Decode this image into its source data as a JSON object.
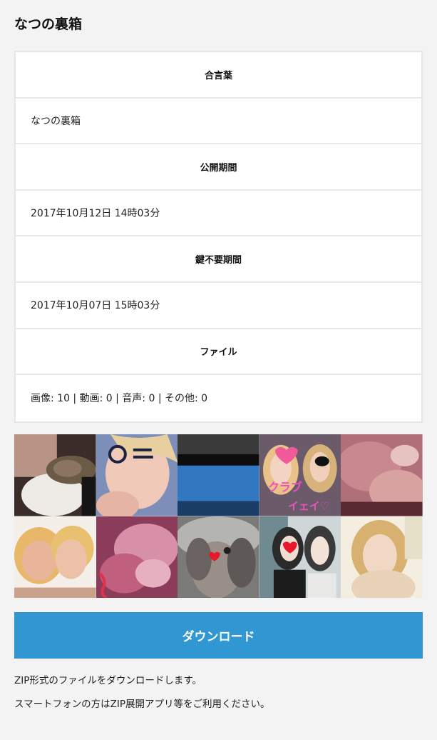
{
  "page": {
    "title": "なつの裏箱"
  },
  "info": {
    "passphrase_label": "合言葉",
    "passphrase_value": "なつの裏箱",
    "period_label": "公開期間",
    "period_value": "2017年10月12日 14時03分",
    "nokey_label": "鍵不要期間",
    "nokey_value": "2017年10月07日 15時03分",
    "file_label": "ファイル",
    "file_value": "画像: 10 | 動画: 0 | 音声: 0 | その他: 0"
  },
  "gallery": {
    "thumbnails": [
      {
        "name": "thumb-1",
        "overlay": ""
      },
      {
        "name": "thumb-2",
        "overlay": "のニ"
      },
      {
        "name": "thumb-3",
        "overlay": ""
      },
      {
        "name": "thumb-4",
        "overlay": "クラブ イェイ♡"
      },
      {
        "name": "thumb-5",
        "overlay": ""
      },
      {
        "name": "thumb-6",
        "overlay": ""
      },
      {
        "name": "thumb-7",
        "overlay": ""
      },
      {
        "name": "thumb-8",
        "overlay": ""
      },
      {
        "name": "thumb-9",
        "overlay": ""
      },
      {
        "name": "thumb-10",
        "overlay": ""
      }
    ]
  },
  "download": {
    "label": "ダウンロード",
    "color": "#3197d2"
  },
  "notes": {
    "line1": "ZIP形式のファイルをダウンロードします。",
    "line2": "スマートフォンの方はZIP展開アプリ等をご利用ください。"
  }
}
